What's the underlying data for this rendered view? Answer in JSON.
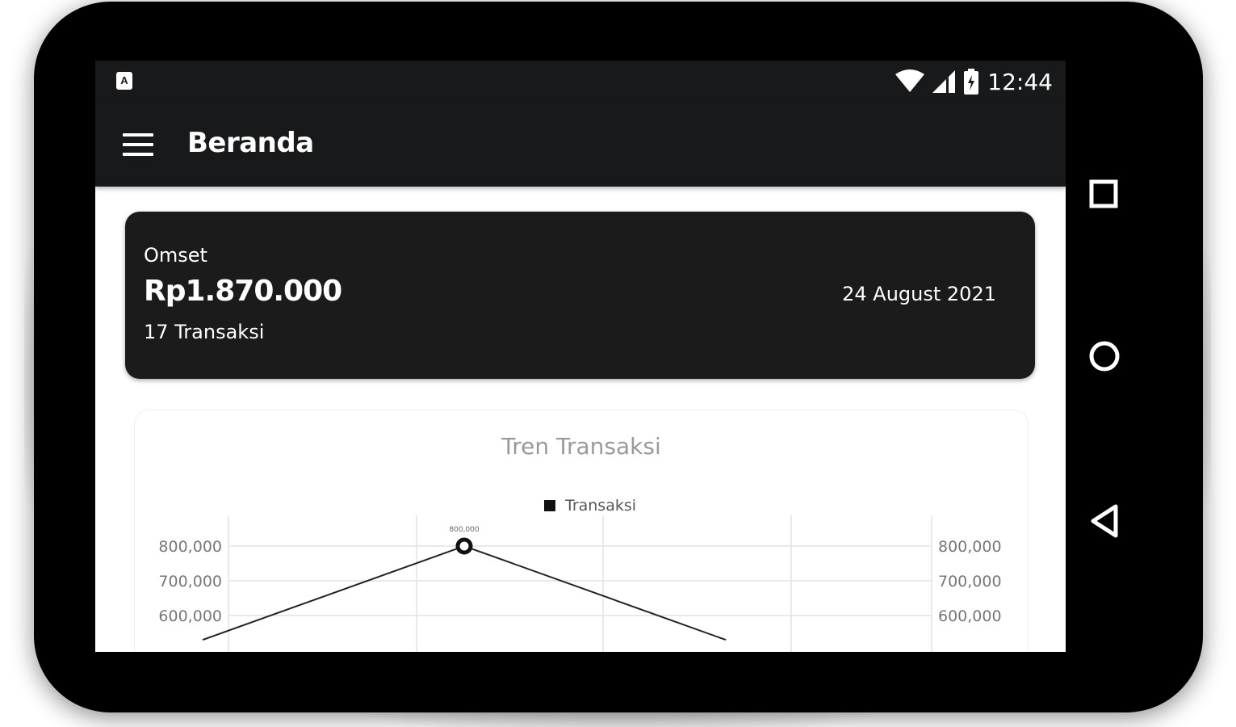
{
  "status_bar": {
    "app_icon": "A",
    "time": "12:44",
    "icons": [
      "wifi-icon",
      "cell-signal-icon",
      "battery-charging-icon"
    ]
  },
  "app_bar": {
    "title": "Beranda",
    "menu_icon": "hamburger-menu-icon"
  },
  "omset_card": {
    "label": "Omset",
    "amount": "Rp1.870.000",
    "date": "24 August 2021",
    "transactions": "17 Transaksi"
  },
  "chart_data": {
    "type": "line",
    "title": "Tren Transaksi",
    "series": [
      {
        "name": "Transaksi",
        "points": [
          [
            -1.2,
            530000
          ],
          [
            0,
            800000
          ],
          [
            1.2,
            530000
          ]
        ]
      }
    ],
    "y_ticks": [
      "800,000",
      "700,000",
      "600,000"
    ],
    "point_label": "800,000",
    "legend_position": "top-center",
    "grid": true,
    "color": "#222222"
  },
  "nav_bar": {
    "buttons": [
      "recents-square-icon",
      "home-circle-icon",
      "back-triangle-icon"
    ]
  },
  "colors": {
    "bar": "#18191b",
    "card": "#1b1b1c",
    "device": "#000000"
  }
}
